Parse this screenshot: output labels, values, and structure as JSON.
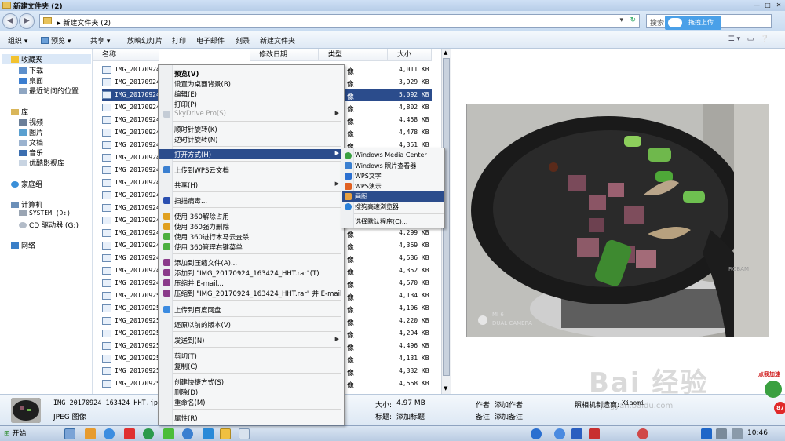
{
  "window": {
    "title": "新建文件夹 (2)",
    "minimize": "—",
    "maximize": "□",
    "close": "✕"
  },
  "address": {
    "crumb": "▸ 新建文件夹 (2)",
    "search_label": "搜索",
    "baidu_upload": "拖拽上传"
  },
  "toolbar": {
    "organize": "组织 ▾",
    "preview": "预览 ▾",
    "share": "共享 ▾",
    "slideshow": "放映幻灯片",
    "print": "打印",
    "email": "电子邮件",
    "burn": "刻录",
    "new_folder": "新建文件夹"
  },
  "sidebar": {
    "favorites": "收藏夹",
    "downloads": "下载",
    "desktop": "桌面",
    "recent": "最近访问的位置",
    "libraries": "库",
    "videos": "视频",
    "pictures": "图片",
    "documents": "文档",
    "music": "音乐",
    "youku": "优酷影视库",
    "homegroup": "家庭组",
    "computer": "计算机",
    "drive_d": "SYSTEM (D:)",
    "drive_g": "CD 驱动器 (G:)",
    "network": "网络"
  },
  "columns": {
    "name": "名称",
    "modified": "修改日期",
    "type": "类型",
    "size": "大小"
  },
  "files": [
    {
      "name": "IMG_20170924_",
      "type": "像",
      "size": "4,011 KB"
    },
    {
      "name": "IMG_20170924_",
      "type": "像",
      "size": "3,929 KB"
    },
    {
      "name": "IMG_20170924_",
      "type": "像",
      "size": "5,092 KB"
    },
    {
      "name": "IMG_20170924_",
      "type": "像",
      "size": "4,802 KB"
    },
    {
      "name": "IMG_20170924_",
      "type": "像",
      "size": "4,458 KB"
    },
    {
      "name": "IMG_20170924_",
      "type": "像",
      "size": "4,478 KB"
    },
    {
      "name": "IMG_20170924_",
      "type": "像",
      "size": "4,351 KB"
    },
    {
      "name": "IMG_20170924_",
      "type": "",
      "size": ""
    },
    {
      "name": "IMG_20170924_",
      "type": "",
      "size": ""
    },
    {
      "name": "IMG_20170924_",
      "type": "",
      "size": ""
    },
    {
      "name": "IMG_20170924_",
      "type": "",
      "size": ""
    },
    {
      "name": "IMG_20170924_",
      "type": "",
      "size": ""
    },
    {
      "name": "IMG_20170924_",
      "type": "",
      "size": ""
    },
    {
      "name": "IMG_20170924_",
      "type": "像",
      "size": "4,299 KB"
    },
    {
      "name": "IMG_20170924_",
      "type": "像",
      "size": "4,369 KB"
    },
    {
      "name": "IMG_20170924_",
      "type": "像",
      "size": "4,586 KB"
    },
    {
      "name": "IMG_20170924_",
      "type": "像",
      "size": "4,352 KB"
    },
    {
      "name": "IMG_20170924_",
      "type": "像",
      "size": "4,570 KB"
    },
    {
      "name": "IMG_20170925_",
      "type": "像",
      "size": "4,134 KB"
    },
    {
      "name": "IMG_20170925_",
      "type": "像",
      "size": "4,106 KB"
    },
    {
      "name": "IMG_20170925_",
      "type": "像",
      "size": "4,220 KB"
    },
    {
      "name": "IMG_20170925_",
      "type": "像",
      "size": "4,294 KB"
    },
    {
      "name": "IMG_20170925_",
      "type": "像",
      "size": "4,496 KB"
    },
    {
      "name": "IMG_20170925_",
      "type": "像",
      "size": "4,131 KB"
    },
    {
      "name": "IMG_20170925_",
      "type": "像",
      "size": "4,332 KB"
    },
    {
      "name": "IMG_20170925_",
      "type": "像",
      "size": "4,568 KB"
    }
  ],
  "context_menu": {
    "preview": "预览(V)",
    "set_bg": "设置为桌面背景(B)",
    "edit": "编辑(E)",
    "print": "打印(P)",
    "skydrive": "SkyDrive Pro(S)",
    "rotate_cw": "顺时针旋转(K)",
    "rotate_ccw": "逆时针旋转(N)",
    "open_with": "打开方式(H)",
    "upload_wps": "上传到WPS云文档",
    "share": "共享(H)",
    "scan_virus": "扫描病毒...",
    "unlock_360": "使用 360解除占用",
    "delete_360": "使用 360强力删除",
    "trojan_360": "使用 360进行木马云查杀",
    "menu_360": "使用 360管理右键菜单",
    "add_archive": "添加到压缩文件(A)...",
    "add_rar": "添加到 \"IMG_20170924_163424_HHT.rar\"(T)",
    "compress_email": "压缩并 E-mail...",
    "compress_rar_email": "压缩到 \"IMG_20170924_163424_HHT.rar\" 并 E-mail",
    "upload_baidu": "上传到百度网盘",
    "restore": "还原以前的版本(V)",
    "send_to": "发送到(N)",
    "cut": "剪切(T)",
    "copy": "复制(C)",
    "shortcut": "创建快捷方式(S)",
    "delete": "删除(D)",
    "rename": "重命名(M)",
    "properties": "属性(R)"
  },
  "open_with_menu": {
    "wmc": "Windows Media Center",
    "photo_viewer": "Windows 照片查看器",
    "wps_writer": "WPS文字",
    "wps_present": "WPS演示",
    "paint": "画图",
    "sogou": "搜狗高速浏览器",
    "choose": "选择默认程序(C)..."
  },
  "details": {
    "filename": "IMG_20170924_163424_HHT.jpg",
    "filetype": "JPEG 图像",
    "size_label": "大小:",
    "size_value": "4.97 MB",
    "tag_label": "标题:",
    "tag_value": "添加标题",
    "author_label": "作者:",
    "author_value": "添加作者",
    "subject_label": "备注:",
    "subject_value": "添加备注",
    "maker_label": "照相机制造商:",
    "maker_value": "Xiaomi"
  },
  "photo": {
    "watermark_line1": "MI 6",
    "watermark_line2": "DUAL CAMERA",
    "brand": "ROBAM"
  },
  "taskbar": {
    "start": "开始",
    "clock": "10:46"
  },
  "overlay": {
    "baidu_wm": "Bai 经验",
    "baidu_url": "jingyan.baidu.com",
    "promo_text": "点我加速",
    "promo_num": "87"
  }
}
